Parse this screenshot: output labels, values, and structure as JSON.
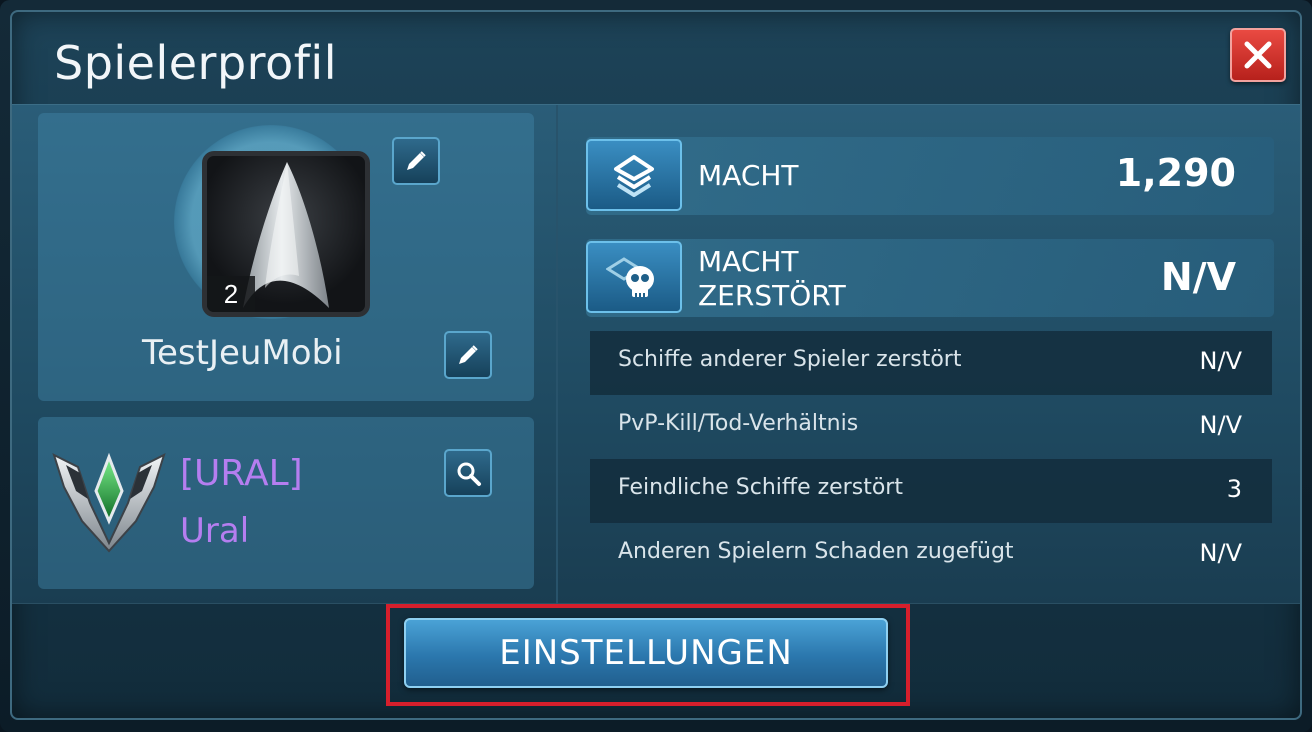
{
  "dialog": {
    "title": "Spielerprofil",
    "close_icon": "close-x-icon"
  },
  "profile": {
    "level": "2",
    "player_name": "TestJeuMobi",
    "avatar_icon": "starfleet-delta-icon",
    "edit_avatar_icon": "pencil-icon",
    "edit_name_icon": "pencil-icon"
  },
  "alliance": {
    "tag": "[URAL]",
    "name": "Ural",
    "emblem_icon": "alliance-emblem-icon",
    "search_icon": "magnifier-icon"
  },
  "stats": {
    "power": {
      "label": "MACHT",
      "value": "1,290",
      "icon": "power-chevron-icon"
    },
    "power_destroyed": {
      "label_line1": "MACHT",
      "label_line2": "ZERSTÖRT",
      "value": "N/V",
      "icon": "power-skull-icon"
    }
  },
  "details": [
    {
      "label": "Schiffe anderer Spieler zerstört",
      "value": "N/V"
    },
    {
      "label": "PvP-Kill/Tod-Verhältnis",
      "value": "N/V"
    },
    {
      "label": "Feindliche Schiffe zerstört",
      "value": "3"
    },
    {
      "label": "Anderen Spielern Schaden zugefügt",
      "value": "N/V"
    }
  ],
  "footer": {
    "settings_label": "EINSTELLUNGEN"
  },
  "colors": {
    "alliance_text": "#b57ef0",
    "highlight_border": "#d61f2c",
    "close_button": "#d9322c"
  }
}
